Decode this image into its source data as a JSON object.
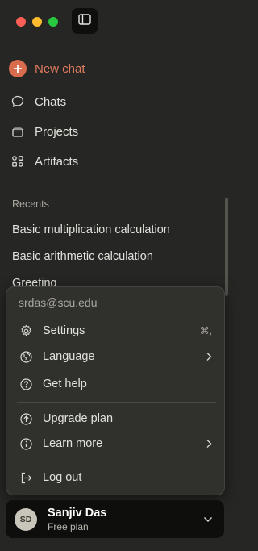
{
  "colors": {
    "close": "#ff5f57",
    "minimize": "#febc2e",
    "zoom": "#28c840",
    "accent": "#d96b4e"
  },
  "window_controls": [
    "close",
    "minimize",
    "zoom"
  ],
  "sidebar_toggle_icon": "sidebar-toggle-icon",
  "nav": {
    "new_chat": "New chat",
    "chats": "Chats",
    "projects": "Projects",
    "artifacts": "Artifacts"
  },
  "recents": {
    "label": "Recents",
    "items": [
      "Basic multiplication calculation",
      "Basic arithmetic calculation",
      "Greeting"
    ]
  },
  "menu": {
    "email": "srdas@scu.edu",
    "settings": "Settings",
    "settings_shortcut": "⌘,",
    "language": "Language",
    "get_help": "Get help",
    "upgrade_plan": "Upgrade plan",
    "learn_more": "Learn more",
    "log_out": "Log out"
  },
  "user": {
    "initials": "SD",
    "name": "Sanjiv Das",
    "plan": "Free plan"
  }
}
